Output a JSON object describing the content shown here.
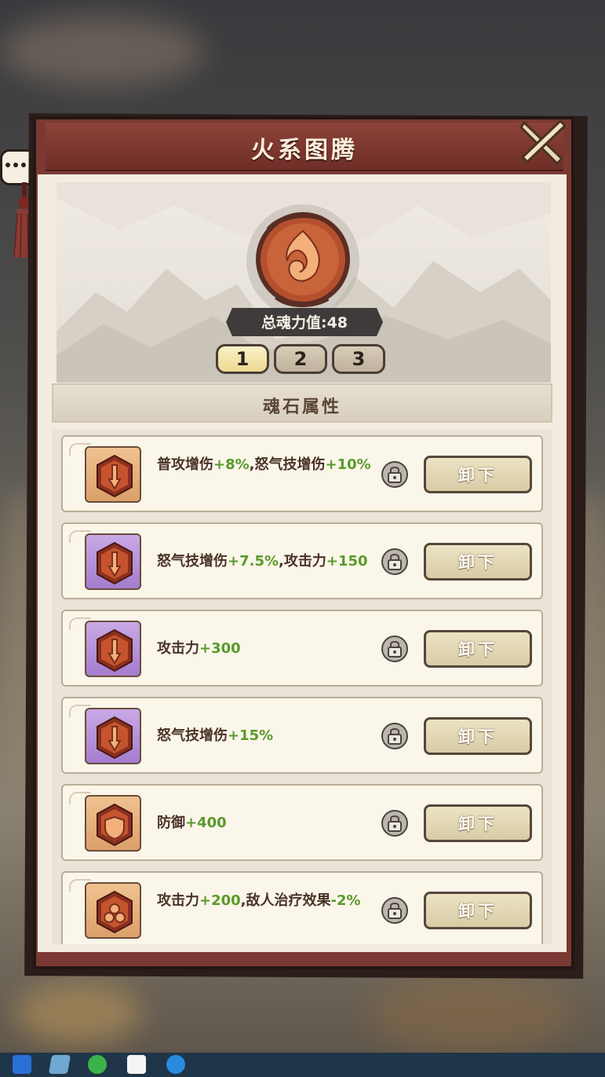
{
  "window": {
    "title": "火系图腾"
  },
  "totem": {
    "soul_power": "总魂力值:48"
  },
  "pages": [
    "1",
    "2",
    "3"
  ],
  "active_page": "1",
  "section": {
    "title": "魂石属性"
  },
  "stones": [
    {
      "frame": "orange",
      "parts": [
        {
          "t": "普攻增伤",
          "p": false
        },
        {
          "t": "+8%",
          "p": true
        },
        {
          "t": ",怒气技增伤",
          "p": false
        },
        {
          "t": "+10%",
          "p": true
        }
      ],
      "button": "卸下"
    },
    {
      "frame": "purple",
      "parts": [
        {
          "t": "怒气技增伤",
          "p": false
        },
        {
          "t": "+7.5%",
          "p": true
        },
        {
          "t": ",攻击力",
          "p": false
        },
        {
          "t": "+150",
          "p": true
        }
      ],
      "button": "卸下"
    },
    {
      "frame": "purple",
      "parts": [
        {
          "t": "攻击力",
          "p": false
        },
        {
          "t": "+300",
          "p": true
        }
      ],
      "button": "卸下"
    },
    {
      "frame": "purple",
      "parts": [
        {
          "t": "怒气技增伤",
          "p": false
        },
        {
          "t": "+15%",
          "p": true
        }
      ],
      "button": "卸下"
    },
    {
      "frame": "orange",
      "parts": [
        {
          "t": "防御",
          "p": false
        },
        {
          "t": "+400",
          "p": true
        }
      ],
      "button": "卸下"
    },
    {
      "frame": "orange",
      "parts": [
        {
          "t": "攻击力",
          "p": false
        },
        {
          "t": "+200",
          "p": true
        },
        {
          "t": ",敌人治疗效果",
          "p": false
        },
        {
          "t": "-2%",
          "p": true
        }
      ],
      "button": "卸下"
    }
  ],
  "colors": {
    "header": "#7a3a33",
    "bonus_green": "#5a9a2a",
    "text_brown": "#4a3328"
  }
}
